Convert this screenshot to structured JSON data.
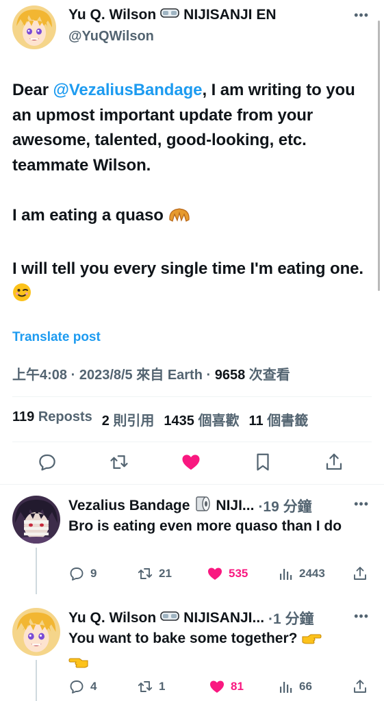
{
  "main_tweet": {
    "display_name": "Yu Q. Wilson",
    "org": "NIJISANJI EN",
    "handle": "@YuQWilson",
    "body": {
      "greeting": "Dear ",
      "mention": "@VezaliusBandage",
      "line1_rest": ", I am writing to you an upmost important update from your awesome, talented, good-looking, etc. teammate Wilson.",
      "line2": "I am eating a quaso ",
      "line3": "I will tell you every single time I'm eating one. "
    },
    "translate_label": "Translate post",
    "meta": {
      "time": "上午4:08",
      "date": "2023/8/5",
      "source_prefix": "來自",
      "source": "Earth",
      "views": "9658",
      "views_label": "次查看",
      "sep": "·"
    },
    "stats": {
      "reposts_count": "119",
      "reposts_label": "Reposts",
      "quotes_count": "2",
      "quotes_label": "則引用",
      "likes_count": "1435",
      "likes_label": "個喜歡",
      "bookmarks_count": "11",
      "bookmarks_label": "個書籤"
    }
  },
  "replies": [
    {
      "display_name": "Vezalius Bandage",
      "org": "NIJI...",
      "time": "·19 分鐘",
      "text": "Bro is eating even more quaso than I do",
      "replies": "9",
      "reposts": "21",
      "likes": "535",
      "views": "2443",
      "liked": true
    },
    {
      "display_name": "Yu Q. Wilson",
      "org": "NIJISANJI...",
      "time": "·1 分鐘",
      "text": "You want to bake some together? ",
      "replies": "4",
      "reposts": "1",
      "likes": "81",
      "views": "66",
      "liked": true
    }
  ],
  "colors": {
    "accent": "#1d9bf0",
    "like": "#f91880",
    "muted": "#536471",
    "text": "#0f1419"
  }
}
